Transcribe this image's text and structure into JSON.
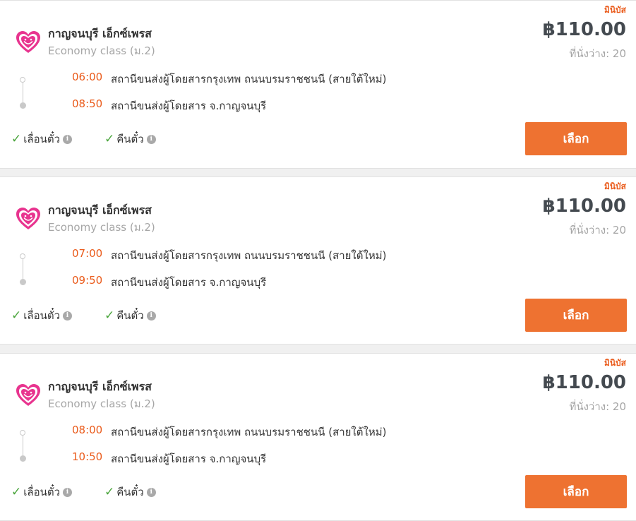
{
  "trips": [
    {
      "bus_type": "มินิบัส",
      "operator": "กาญจนบุรี เอ็กซ์เพรส",
      "class": "Economy class (ม.2)",
      "price": "฿110.00",
      "seats": "ที่นั่งว่าง: 20",
      "departure_time": "06:00",
      "departure_stop": "สถานีขนส่งผู้โดยสารกรุงเทพ ถนนบรมราชชนนี (สายใต้ใหม่)",
      "arrival_time": "08:50",
      "arrival_stop": "สถานีขนส่งผู้โดยสาร จ.กาญจนบุรี",
      "option_reschedule": "เลื่อนตั๋ว",
      "option_refund": "คืนตั๋ว",
      "select_label": "เลือก"
    },
    {
      "bus_type": "มินิบัส",
      "operator": "กาญจนบุรี เอ็กซ์เพรส",
      "class": "Economy class (ม.2)",
      "price": "฿110.00",
      "seats": "ที่นั่งว่าง: 20",
      "departure_time": "07:00",
      "departure_stop": "สถานีขนส่งผู้โดยสารกรุงเทพ ถนนบรมราชชนนี (สายใต้ใหม่)",
      "arrival_time": "09:50",
      "arrival_stop": "สถานีขนส่งผู้โดยสาร จ.กาญจนบุรี",
      "option_reschedule": "เลื่อนตั๋ว",
      "option_refund": "คืนตั๋ว",
      "select_label": "เลือก"
    },
    {
      "bus_type": "มินิบัส",
      "operator": "กาญจนบุรี เอ็กซ์เพรส",
      "class": "Economy class (ม.2)",
      "price": "฿110.00",
      "seats": "ที่นั่งว่าง: 20",
      "departure_time": "08:00",
      "departure_stop": "สถานีขนส่งผู้โดยสารกรุงเทพ ถนนบรมราชชนนี (สายใต้ใหม่)",
      "arrival_time": "10:50",
      "arrival_stop": "สถานีขนส่งผู้โดยสาร จ.กาญจนบุรี",
      "option_reschedule": "เลื่อนตั๋ว",
      "option_refund": "คืนตั๋ว",
      "select_label": "เลือก"
    }
  ],
  "icons": {
    "logo": "heart-smile-logo-icon",
    "check": "check-icon",
    "info": "info-icon"
  },
  "colors": {
    "accent": "#ee7231",
    "time": "#ea5b1b",
    "check": "#4aa53c",
    "logo_pink": "#e8348f"
  }
}
